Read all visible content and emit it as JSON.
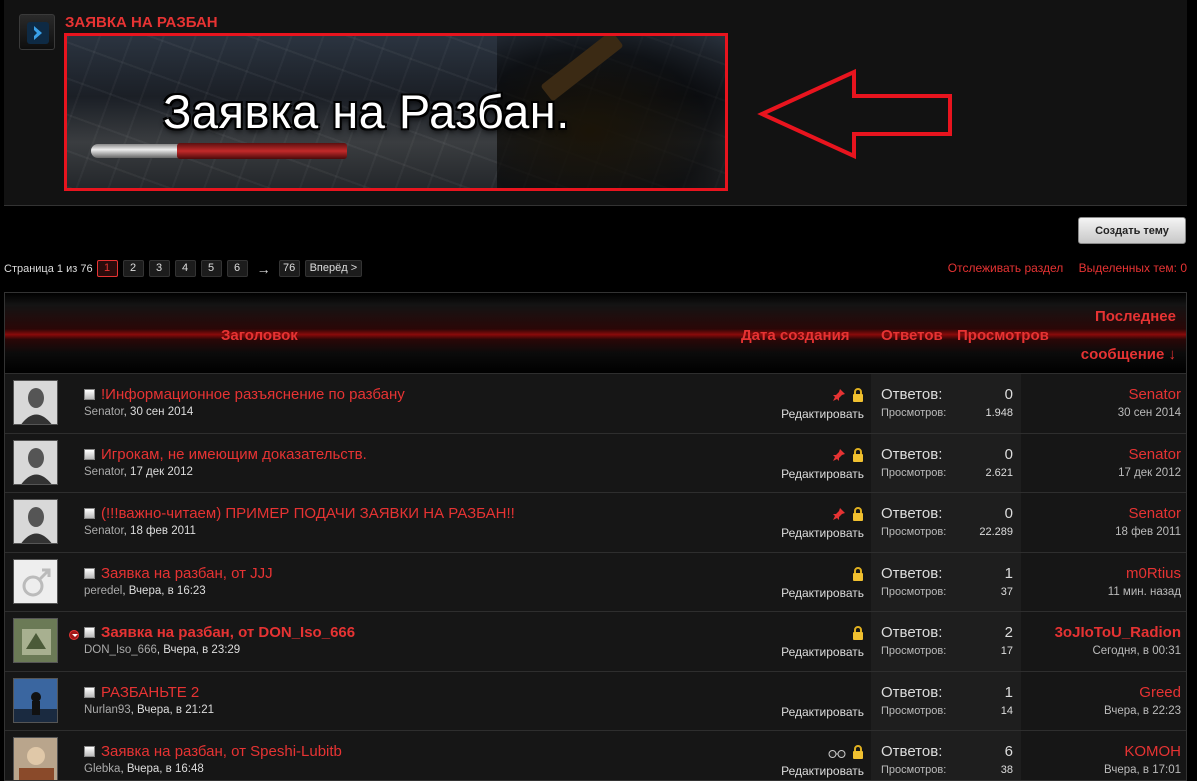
{
  "forum": {
    "title": "ЗАЯВКА НА РАЗБАН",
    "banner_text": "Заявка на Разбан."
  },
  "colors": {
    "accent": "#e63333",
    "annotation": "#e8141e",
    "background": "#000000"
  },
  "toolbar": {
    "create_thread": "Создать тему"
  },
  "pagination": {
    "label": "Страница 1 из 76",
    "pages": [
      "1",
      "2",
      "3",
      "4",
      "5",
      "6"
    ],
    "current": "1",
    "arrow": "→",
    "last": "76",
    "next": "Вперёд >"
  },
  "links": {
    "watch": "Отслеживать раздел",
    "selected": "Выделенных тем: 0"
  },
  "columns": {
    "title": "Заголовок",
    "created": "Дата создания",
    "replies": "Ответов",
    "views": "Просмотров",
    "last_line1": "Последнее",
    "last_line2": "сообщение ↓"
  },
  "labels": {
    "replies": "Ответов:",
    "views": "Просмотров:",
    "edit": "Редактировать"
  },
  "threads": [
    {
      "title": "!Информационное разъяснение по разбану",
      "author": "Senator",
      "date": "30 сен 2014",
      "replies": "0",
      "views": "1.948",
      "last_user": "Senator",
      "last_date": "30 сен 2014",
      "icons": [
        "pin-icon",
        "lock-icon"
      ]
    },
    {
      "title": "Игрокам, не имеющим доказательств.",
      "author": "Senator",
      "date": "17 дек 2012",
      "replies": "0",
      "views": "2.621",
      "last_user": "Senator",
      "last_date": "17 дек 2012",
      "icons": [
        "pin-icon",
        "lock-icon"
      ]
    },
    {
      "title": "(!!!важно-читаем) ПРИМЕР ПОДАЧИ ЗАЯВКИ НА РАЗБАН!!",
      "author": "Senator",
      "date": "18 фев 2011",
      "replies": "0",
      "views": "22.289",
      "last_user": "Senator",
      "last_date": "18 фев 2011",
      "icons": [
        "pin-icon",
        "lock-icon"
      ]
    },
    {
      "title": "Заявка на разбан, от JJJ",
      "author": "peredel",
      "date": "Вчера, в 16:23",
      "replies": "1",
      "views": "37",
      "last_user": "m0Rtius",
      "last_date": "11 мин. назад",
      "icons": [
        "lock-icon"
      ]
    },
    {
      "title": "Заявка на разбан, от DON_Iso_666",
      "author": "DON_Iso_666",
      "date": "Вчера, в 23:29",
      "replies": "2",
      "views": "17",
      "last_user": "3oJIoToU_Radion",
      "last_date": "Сегодня, в 00:31",
      "icons": [
        "lock-icon"
      ],
      "unread": true
    },
    {
      "title": "РАЗБАНЬТЕ 2",
      "author": "Nurlan93",
      "date": "Вчера, в 21:21",
      "replies": "1",
      "views": "14",
      "last_user": "Greed",
      "last_date": "Вчера, в 22:23",
      "icons": []
    },
    {
      "title": "Заявка на разбан, от Speshi-Lubitb",
      "author": "Glebka",
      "date": "Вчера, в 16:48",
      "replies": "6",
      "views": "38",
      "last_user": "KOMOH",
      "last_date": "Вчера, в 17:01",
      "icons": [
        "glasses-icon",
        "lock-icon"
      ]
    }
  ]
}
